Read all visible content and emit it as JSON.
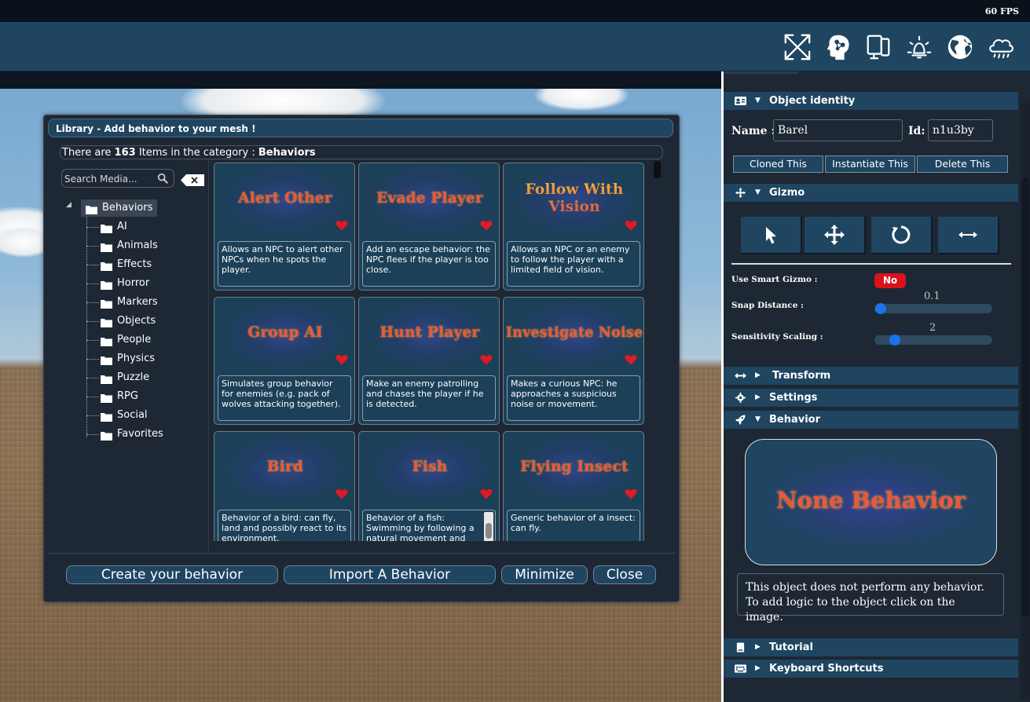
{
  "fps": "60 FPS",
  "toolbar": {
    "icons": [
      "fullscreen-icon",
      "ai-brain-icon",
      "device-layout-icon",
      "light-icon",
      "globe-icon",
      "cloud-rain-icon"
    ]
  },
  "library": {
    "title": "Library - Add behavior to your mesh !",
    "count_prefix": "There are",
    "count": "163",
    "count_middle": "Items in the category :",
    "category": "Behaviors",
    "search_placeholder": "Search Media...",
    "tree": {
      "root": "Behaviors",
      "children": [
        "AI",
        "Animals",
        "Effects",
        "Horror",
        "Markers",
        "Objects",
        "People",
        "Physics",
        "Puzzle",
        "RPG",
        "Social",
        "Favorites"
      ]
    },
    "cards": [
      {
        "title": "Alert Other",
        "desc": "Allows an NPC to alert other NPCs when he spots the player."
      },
      {
        "title": "Evade Player",
        "desc": "Add an escape behavior: the NPC flees if the player is too close."
      },
      {
        "title": "Follow With Vision",
        "desc": "Allows an NPC or an enemy to follow the player with a limited field of vision."
      },
      {
        "title": "Group AI",
        "desc": "Simulates group behavior for enemies (e.g. pack of wolves attacking together)."
      },
      {
        "title": "Hunt Player",
        "desc": "Make an enemy patrolling and chases the player if he is detected."
      },
      {
        "title": "Investigate Noise",
        "desc": "Makes a curious NPC: he approaches a suspicious noise or movement."
      },
      {
        "title": "Bird",
        "desc": "Behavior of a bird: can fly, land and possibly react to its environment."
      },
      {
        "title": "Fish",
        "desc": "Behavior of a fish: Swimming by following a natural movement and"
      },
      {
        "title": "Flying Insect",
        "desc": "Generic behavior of a insect: can fly."
      }
    ],
    "buttons": {
      "create": "Create your behavior",
      "import": "Import A Behavior",
      "minimize": "Minimize",
      "close": "Close"
    }
  },
  "panel": {
    "object_identity": "Object identity",
    "name_label": "Name :",
    "name_value": "Barel",
    "id_label": "Id:",
    "id_value": "n1u3by",
    "cloned_this": "Cloned This",
    "instantiate_this": "Instantiate This",
    "delete_this": "Delete This",
    "gizmo": "Gizmo",
    "use_smart_gizmo": "Use Smart Gizmo :",
    "smart_gizmo_value": "No",
    "snap_distance": "Snap Distance :",
    "snap_value": "0.1",
    "sensitivity_scaling": "Sensitivity Scaling :",
    "sensitivity_value": "2",
    "transform": "Transform",
    "settings": "Settings",
    "behavior": "Behavior",
    "behavior_title": "None Behavior",
    "behavior_desc": "This object does not perform any behavior. To add logic to the object click on the image.",
    "tutorial": "Tutorial",
    "keyboard_shortcuts": "Keyboard Shortcuts"
  },
  "colors": {
    "toolbar": "#1f4560",
    "panel": "#1e2734",
    "accent_red": "#d9131a",
    "slider_blue": "#1a73e8",
    "title_orange": "#e8583e"
  }
}
